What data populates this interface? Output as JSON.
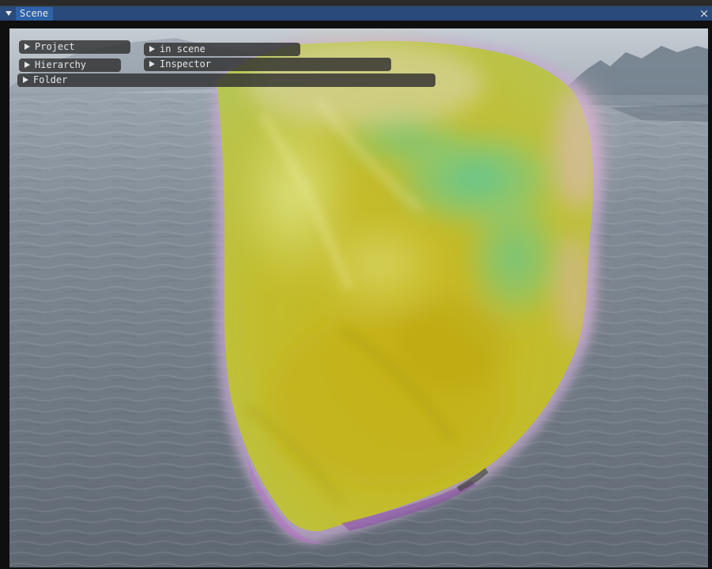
{
  "window": {
    "tab_label": "Scene",
    "close_glyph": "×",
    "menu_icon": "triangle-down-icon"
  },
  "panels": {
    "project": "Project",
    "in_scene": "in scene",
    "hierarchy": "Hierarchy",
    "inspector": "Inspector",
    "folder": "Folder",
    "expand_icon": "triangle-right-icon"
  },
  "colors": {
    "title_bar": "#294a7a",
    "tab_active": "#2f62a8",
    "panel_pill": "#303030"
  }
}
